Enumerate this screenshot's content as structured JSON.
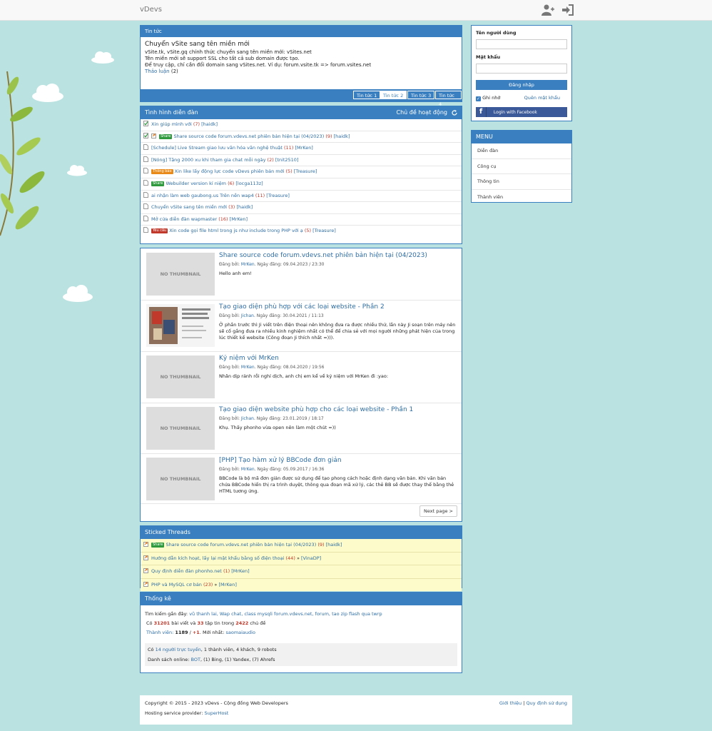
{
  "colors": {
    "primary": "#3a7fbf",
    "background": "#b9e2e0",
    "link": "#2e6da4",
    "count": "#c0392b",
    "sticky": "#fdfbc9"
  },
  "navbar": {
    "brand": "vDevs",
    "icons": [
      "user-plus-icon",
      "sign-in-icon"
    ]
  },
  "news": {
    "header": "Tin tức",
    "title": "Chuyển vSite sang tên miền mới",
    "lines": [
      "vSite.tk, vSite.gq chính thức chuyển sang tên miền mới: vSites.net",
      "Tên miền mới sẽ support SSL cho tất cả sub domain được tạo.",
      "Để truy cập, chỉ cần đổi domain sang vSites.net. Ví dụ: forum.vsite.tk => forum.vsites.net"
    ],
    "discuss_label": "Thảo luận",
    "discuss_count": "(2)",
    "tabs": [
      "Tin tức 1",
      "Tin tức 2",
      "Tin tức 3",
      "Tin tức 4"
    ],
    "active_tab": 1
  },
  "forum": {
    "header": "Tình hình diễn đàn",
    "header_right": "Chủ đề hoạt động",
    "threads": [
      {
        "icon": "check",
        "badge": "",
        "badge_type": "",
        "title": "Xin giúp mình với",
        "count": "(7)",
        "author": "[haidk]"
      },
      {
        "icon": "check-sticky",
        "badge": "Share",
        "badge_type": "share",
        "title": "Share source code forum.vdevs.net phiên bản hiện tại (04/2023)",
        "count": "(9)",
        "author": "[haidk]"
      },
      {
        "icon": "doc",
        "badge": "",
        "badge_type": "",
        "title": "[Schedule] Live Stream giao lưu văn hóa văn nghệ thuật",
        "count": "(11)",
        "author": "[MrKen]"
      },
      {
        "icon": "doc",
        "badge": "",
        "badge_type": "",
        "title": "[Nóng] Tặng 2000 xu khi tham gia chat mỗi ngày",
        "count": "(2)",
        "author": "[tnit2510]"
      },
      {
        "icon": "doc",
        "badge": "Thông báo",
        "badge_type": "notice",
        "title": "Xin like lấy động lực code vDevs phiên bản mới",
        "count": "(5)",
        "author": "[Treasure]"
      },
      {
        "icon": "doc",
        "badge": "Share",
        "badge_type": "share",
        "title": "Webuilder version kỉ niệm",
        "count": "(6)",
        "author": "[locga113z]"
      },
      {
        "icon": "doc",
        "badge": "",
        "badge_type": "",
        "title": "ai nhận làm web gaubong.us Trên nền wap4",
        "count": "(11)",
        "author": "[Treasure]"
      },
      {
        "icon": "doc",
        "badge": "",
        "badge_type": "",
        "title": "Chuyển vSite sang tên miền mới",
        "count": "(3)",
        "author": "[haidk]"
      },
      {
        "icon": "doc",
        "badge": "",
        "badge_type": "",
        "title": "Mở cửa diễn đàn wapmaster",
        "count": "(16)",
        "author": "[MrKen]"
      },
      {
        "icon": "doc",
        "badge": "Yêu cầu",
        "badge_type": "req",
        "title": "Xin code gọi file html trong js như include trong PHP với ạ",
        "count": "(5)",
        "author": "[Treasure]"
      }
    ]
  },
  "articles": [
    {
      "title": "Share source code forum.vdevs.net phiên bản hiện tại (04/2023)",
      "by": "Đăng bởi:",
      "author": "MrKen",
      "date_label": "Ngày đăng:",
      "date": "09.04.2023 / 23:30",
      "text": "Hello anh em!",
      "thumb": "NO THUMBNAIL"
    },
    {
      "title": "Tạo giao diện phù hợp với các loại website - Phần 2",
      "by": "Đăng bởi:",
      "author": "Jichan",
      "date_label": "Ngày đăng:",
      "date": "30.04.2021 / 11:13",
      "text": "Ở phần trước thì Ji viết trên điện thoại nên không đưa ra được nhiều thứ, lần này Ji soạn trên máy nên sẽ cố gắng đưa ra nhiều kinh nghiệm nhất có thể để chia sẻ với mọi người những phát hiện của trong lúc thiết kế website (Công đoạn Ji thích nhất =))).",
      "thumb": ""
    },
    {
      "title": "Kỷ niệm với MrKen",
      "by": "Đăng bởi:",
      "author": "MrKen",
      "date_label": "Ngày đăng:",
      "date": "08.04.2020 / 19:56",
      "text": "Nhân dịp rảnh rỗi nghỉ dịch, anh chị em kể về kỷ niệm với MrKen đi :yao:",
      "thumb": "NO THUMBNAIL"
    },
    {
      "title": "Tạo giao diện website phù hợp cho các loại website - Phần 1",
      "by": "Đăng bởi:",
      "author": "Jichan",
      "date_label": "Ngày đăng:",
      "date": "23.01.2019 / 18:17",
      "text": "Khụ. Thấy phonho vừa open nên làm một chút =))",
      "thumb": "NO THUMBNAIL"
    },
    {
      "title": "[PHP] Tạo hàm xử lý BBCode đơn giản",
      "by": "Đăng bởi:",
      "author": "MrKen",
      "date_label": "Ngày đăng:",
      "date": "05.09.2017 / 16:36",
      "text": "BBCode là bộ mã đơn giản được sử dụng để tạo phong cách hoặc định dạng văn bản. Khi văn bản chứa BBCode hiển thị ra trình duyệt, thông qua đoạn mã xử lý, các thẻ BB sẽ được thay thế bằng thẻ HTML tương ứng.",
      "thumb": "NO THUMBNAIL"
    }
  ],
  "pagination": {
    "next": "Next page >"
  },
  "sticky": {
    "header": "Sticked Threads",
    "threads": [
      {
        "badge": "Share",
        "title": "Share source code forum.vdevs.net phiên bản hiện tại (04/2023)",
        "count": "(9)",
        "author": "[haidk]",
        "arrow": ""
      },
      {
        "badge": "",
        "title": "Hướng dẫn kích hoạt, lấy lại mật khẩu bằng số điện thoại",
        "count": "(44)",
        "author": "[VinaDP]",
        "arrow": "»"
      },
      {
        "badge": "",
        "title": "Quy định diễn đàn phonho.net",
        "count": "(1)",
        "author": "[MrKen]",
        "arrow": ""
      },
      {
        "badge": "",
        "title": "PHP và MySQL cơ bản",
        "count": "(23)",
        "author": "[MrKen]",
        "arrow": "»"
      }
    ]
  },
  "stats": {
    "header": "Thống kê",
    "recent_label": "Tìm kiếm gần đây:",
    "recent": "vũ thanh lai, Wap chat, class mysqli forum.vdevs.net, forum, tao zip flash qua twrp",
    "posts_prefix": "Có",
    "posts": "31201",
    "posts_mid": "bài viết và",
    "topics": "33",
    "topics_mid": "tập tin trong",
    "threads": "2422",
    "threads_suffix": "chủ đề",
    "members_label": "Thành viên:",
    "members": "1189",
    "members_new": "+1",
    "newest_label": ". Mới nhất:",
    "newest": "saomaiaudio",
    "online_prefix": "Có",
    "online_link": "14 người trực tuyến",
    "online_rest": ", 1 thành viên, 4 khách, 9 robots",
    "online_list_label": "Danh sách online:",
    "online_list_link": "BOT",
    "online_list_rest": ", (1) Bing, (1) Yandex, (7) Ahrefs"
  },
  "login": {
    "username_label": "Tên người dùng",
    "password_label": "Mật khẩu",
    "button": "Đăng nhập",
    "remember": "Ghi nhớ",
    "forgot": "Quên mật khẩu",
    "facebook": "Login with Facebook"
  },
  "menu": {
    "header": "MENU",
    "items": [
      "Diễn đàn",
      "Công cụ",
      "Thông tin",
      "Thành viên"
    ]
  },
  "footer": {
    "copyright": "Copyright © 2015 - 2023 vDevs - Cộng đồng Web Developers",
    "hosting_label": "Hosting service provider:",
    "hosting": "SuperHost",
    "about": "Giới thiệu",
    "sep": "|",
    "terms": "Quy định sử dụng"
  }
}
